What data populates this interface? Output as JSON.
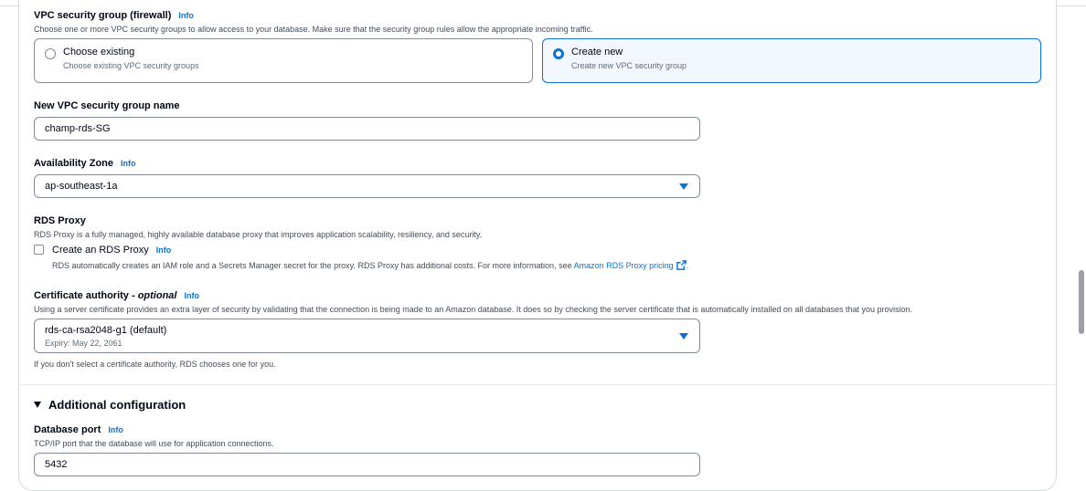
{
  "vpc_sg": {
    "label": "VPC security group (firewall)",
    "info": "Info",
    "description": "Choose one or more VPC security groups to allow access to your database. Make sure that the security group rules allow the appropriate incoming traffic.",
    "options": [
      {
        "title": "Choose existing",
        "subtitle": "Choose existing VPC security groups",
        "selected": false
      },
      {
        "title": "Create new",
        "subtitle": "Create new VPC security group",
        "selected": true
      }
    ]
  },
  "new_sg_name": {
    "label": "New VPC security group name",
    "value": "champ-rds-SG"
  },
  "availability_zone": {
    "label": "Availability Zone",
    "info": "Info",
    "value": "ap-southeast-1a"
  },
  "rds_proxy": {
    "label": "RDS Proxy",
    "description": "RDS Proxy is a fully managed, highly available database proxy that improves application scalability, resiliency, and security.",
    "checkbox_label": "Create an RDS Proxy",
    "info": "Info",
    "checked": false,
    "note": "RDS automatically creates an IAM role and a Secrets Manager secret for the proxy. RDS Proxy has additional costs. For more information, see",
    "link_text": "Amazon RDS Proxy pricing",
    "note_end": "."
  },
  "certificate_authority": {
    "label_main": "Certificate authority - ",
    "label_optional": "optional",
    "info": "Info",
    "description": "Using a server certificate provides an extra layer of security by validating that the connection is being made to an Amazon database. It does so by checking the server certificate that is automatically installed on all databases that you provision.",
    "value": "rds-ca-rsa2048-g1 (default)",
    "expiry": "Expiry: May 22, 2061",
    "hint": "If you don't select a certificate authority, RDS chooses one for you."
  },
  "additional_config": {
    "heading": "Additional configuration",
    "expanded": true
  },
  "database_port": {
    "label": "Database port",
    "info": "Info",
    "description": "TCP/IP port that the database will use for application connections.",
    "value": "5432"
  },
  "colors": {
    "accent": "#0972d3",
    "text": "#000716",
    "secondary_text": "#414d5c",
    "border": "#7d8998"
  },
  "icons": [
    "radio-icon",
    "chevron-down-icon",
    "checkbox-icon",
    "external-link-icon",
    "caret-down-icon"
  ]
}
